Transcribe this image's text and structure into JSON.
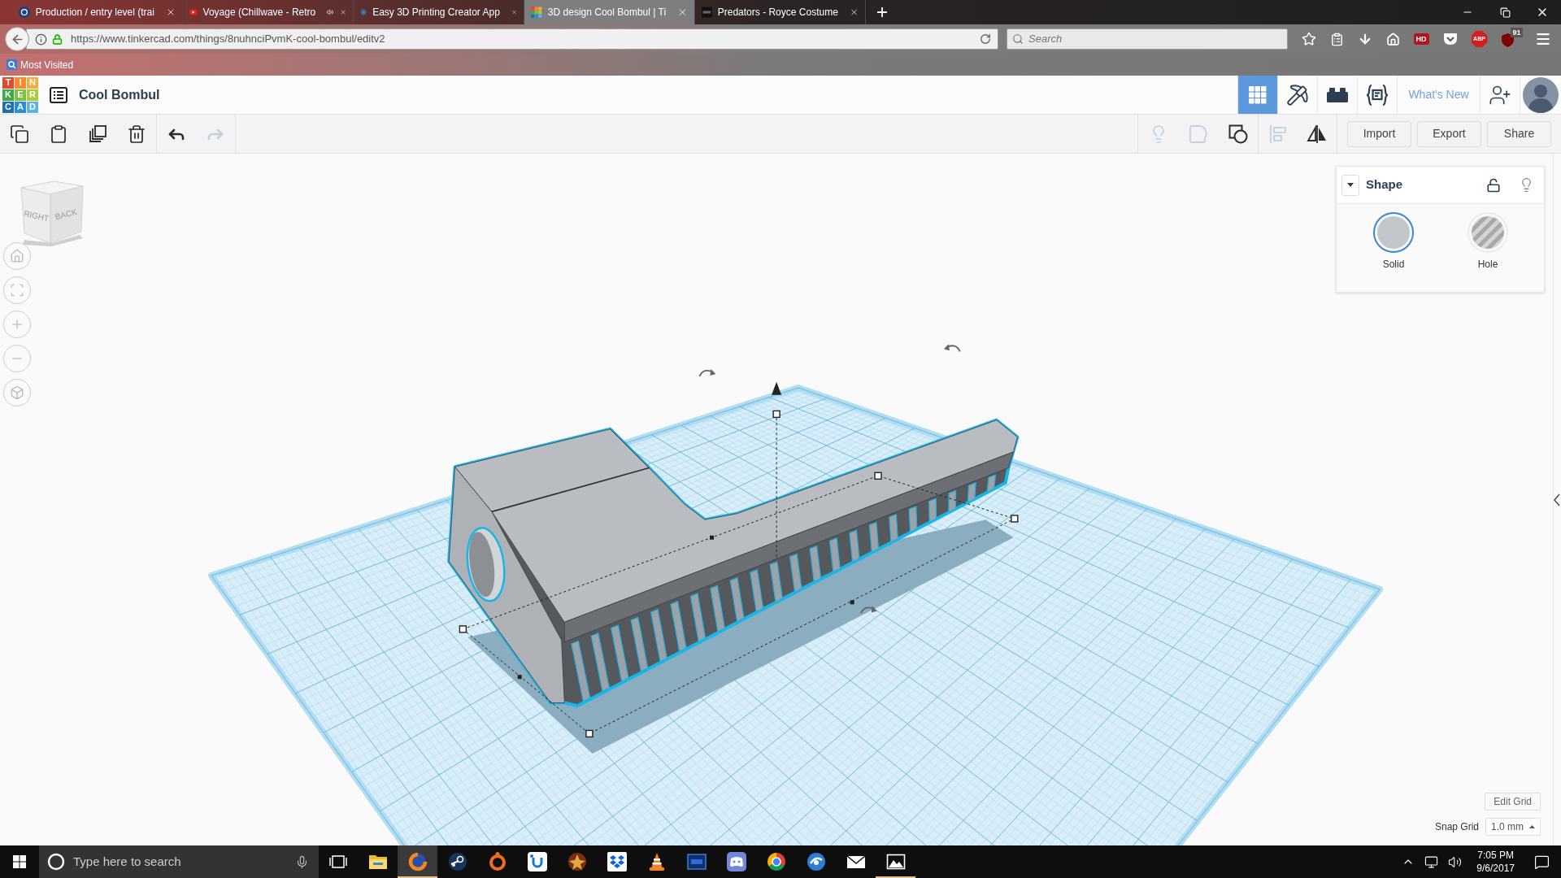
{
  "browser": {
    "tabs": [
      {
        "kind": "ksl",
        "title": "Production / entry level (trai",
        "audio": false,
        "selected": false
      },
      {
        "kind": "youtube",
        "title": "Voyage (Chillwave - Retro",
        "audio": true,
        "selected": false
      },
      {
        "kind": "sparkle",
        "title": "Easy 3D Printing Creator App",
        "audio": false,
        "selected": false
      },
      {
        "kind": "grid",
        "title": "3D design Cool Bombul | Ti",
        "audio": false,
        "selected": true
      },
      {
        "kind": "dark",
        "title": "Predators - Royce Costume",
        "audio": false,
        "selected": false
      }
    ],
    "url": "https://www.tinkercad.com/things/8nuhnciPvmK-cool-bombul/editv2",
    "search": {
      "placeholder": "Search"
    },
    "extensions": [
      {
        "kind": "hd",
        "label": "HD"
      },
      {
        "kind": "pocket"
      },
      {
        "kind": "abp",
        "label": "ABP"
      },
      {
        "kind": "shield",
        "badge": "91"
      }
    ],
    "bookmarks": [
      "Most Visited"
    ]
  },
  "app": {
    "logo": [
      {
        "letter": "T",
        "color": "#e4492e"
      },
      {
        "letter": "I",
        "color": "#f58b2d"
      },
      {
        "letter": "N",
        "color": "#f7a93b"
      },
      {
        "letter": "K",
        "color": "#3ea945"
      },
      {
        "letter": "E",
        "color": "#7dc142"
      },
      {
        "letter": "R",
        "color": "#a9cd37"
      },
      {
        "letter": "C",
        "color": "#1c6fb5"
      },
      {
        "letter": "A",
        "color": "#2a8fd0"
      },
      {
        "letter": "D",
        "color": "#5ab3e3"
      }
    ],
    "title": "Cool Bombul",
    "views": [
      {
        "kind": "grid",
        "selected": true
      },
      {
        "kind": "pickaxe",
        "selected": false
      },
      {
        "kind": "brick",
        "selected": false
      },
      {
        "kind": "code",
        "selected": false
      }
    ],
    "whats_new": "What's New"
  },
  "toolbar": {
    "edit": [
      {
        "kind": "copy",
        "disabled": false
      },
      {
        "kind": "paste",
        "disabled": false
      },
      {
        "kind": "duplicate",
        "disabled": false
      },
      {
        "kind": "delete",
        "disabled": false
      }
    ],
    "history": [
      {
        "kind": "undo",
        "disabled": false
      },
      {
        "kind": "redo",
        "disabled": true
      }
    ],
    "shape_tools": [
      {
        "kind": "bulb",
        "disabled": true
      },
      {
        "kind": "blob",
        "disabled": true
      },
      {
        "kind": "group",
        "disabled": false
      }
    ],
    "arrange_tools": [
      {
        "kind": "align",
        "disabled": true
      },
      {
        "kind": "mirror",
        "disabled": false
      }
    ],
    "buttons": [
      "Import",
      "Export",
      "Share"
    ]
  },
  "view_cube": {
    "faces": [
      "RIGHT",
      "BACK"
    ]
  },
  "shape_panel": {
    "title": "Shape",
    "options": [
      {
        "kind": "solid",
        "label": "Solid",
        "selected": true
      },
      {
        "kind": "hole",
        "label": "Hole",
        "selected": false
      }
    ]
  },
  "grid": {
    "edit_button": "Edit Grid",
    "snap_label": "Snap Grid",
    "snap_value": "1.0 mm"
  },
  "taskbar": {
    "search": {
      "placeholder": "Type here to search"
    },
    "apps": [
      {
        "kind": "folder",
        "selected": false,
        "running": false
      },
      {
        "kind": "globe",
        "selected": true,
        "running": true
      },
      {
        "kind": "key",
        "selected": false,
        "running": false
      },
      {
        "kind": "ring",
        "selected": false,
        "running": false
      },
      {
        "kind": "utile",
        "selected": false,
        "running": false
      },
      {
        "kind": "star",
        "selected": false,
        "running": false
      },
      {
        "kind": "box",
        "selected": false,
        "running": false
      },
      {
        "kind": "cone",
        "selected": false,
        "running": false
      },
      {
        "kind": "frame",
        "selected": false,
        "running": false
      },
      {
        "kind": "gamepad",
        "selected": false,
        "running": false
      },
      {
        "kind": "segmented",
        "selected": false,
        "running": false
      },
      {
        "kind": "eye",
        "selected": false,
        "running": false
      },
      {
        "kind": "envelope",
        "selected": false,
        "running": false
      },
      {
        "kind": "landscape",
        "selected": false,
        "running": true
      }
    ],
    "time": "7:05 PM",
    "date": "9/6/2017"
  }
}
